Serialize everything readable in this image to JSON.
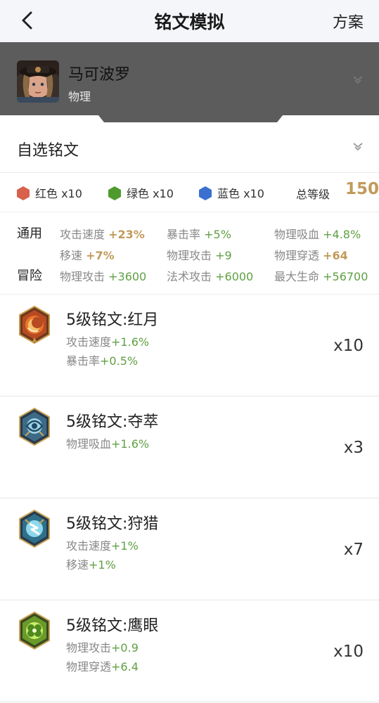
{
  "header": {
    "title": "铭文模拟",
    "plan_label": "方案",
    "back_icon": "chevron-left-icon"
  },
  "hero": {
    "name": "马可波罗",
    "type": "物理"
  },
  "preset": {
    "label": "自选铭文"
  },
  "colors": {
    "red": {
      "label": "红色 x10",
      "color": "#d8604c"
    },
    "green": {
      "label": "绿色 x10",
      "color": "#4f9a2e"
    },
    "blue": {
      "label": "蓝色 x10",
      "color": "#3b6fd0"
    },
    "total_label": "总等级",
    "total_value": "150"
  },
  "stats": {
    "general_label": "通用",
    "adventure_label": "冒险",
    "general": [
      {
        "name": "攻击速度",
        "value": "+23%",
        "highlight": true
      },
      {
        "name": "暴击率",
        "value": "+5%",
        "highlight": false
      },
      {
        "name": "物理吸血",
        "value": "+4.8%",
        "highlight": false
      },
      {
        "name": "移速",
        "value": "+7%",
        "highlight": true
      },
      {
        "name": "物理攻击",
        "value": "+9",
        "highlight": false
      },
      {
        "name": "物理穿透",
        "value": "+64",
        "highlight": true
      }
    ],
    "adventure": [
      {
        "name": "物理攻击",
        "value": "+3600"
      },
      {
        "name": "法术攻击",
        "value": "+6000"
      },
      {
        "name": "最大生命",
        "value": "+56700"
      }
    ]
  },
  "inscriptions": [
    {
      "name": "5级铭文:红月",
      "icon": "red-moon-icon",
      "count": "x10",
      "effects": [
        {
          "name": "攻击速度",
          "value": "+1.6%"
        },
        {
          "name": "暴击率",
          "value": "+0.5%"
        }
      ]
    },
    {
      "name": "5级铭文:夺萃",
      "icon": "plunder-icon",
      "count": "x3",
      "effects": [
        {
          "name": "物理吸血",
          "value": "+1.6%"
        }
      ]
    },
    {
      "name": "5级铭文:狩猎",
      "icon": "hunt-icon",
      "count": "x7",
      "effects": [
        {
          "name": "攻击速度",
          "value": "+1%"
        },
        {
          "name": "移速",
          "value": "+1%"
        }
      ]
    },
    {
      "name": "5级铭文:鹰眼",
      "icon": "hawkeye-icon",
      "count": "x10",
      "effects": [
        {
          "name": "物理攻击",
          "value": "+0.9"
        },
        {
          "name": "物理穿透",
          "value": "+6.4"
        }
      ]
    }
  ]
}
